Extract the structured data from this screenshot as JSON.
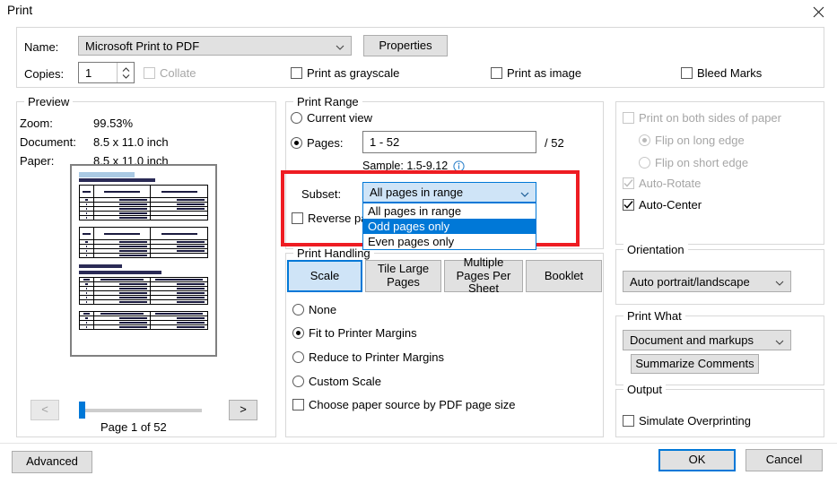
{
  "window": {
    "title": "Print",
    "close_icon": "close-icon"
  },
  "printer": {
    "name_label": "Name:",
    "name_value": "Microsoft Print to PDF",
    "properties_label": "Properties",
    "copies_label": "Copies:",
    "copies_value": "1",
    "collate_label": "Collate",
    "collate_checked": false,
    "collate_enabled": false,
    "print_as_grayscale_label": "Print as grayscale",
    "print_as_image_label": "Print as image",
    "bleed_marks_label": "Bleed Marks"
  },
  "preview": {
    "legend": "Preview",
    "zoom_label": "Zoom:",
    "zoom_value": "99.53%",
    "document_label": "Document:",
    "document_value": "8.5 x 11.0 inch",
    "paper_label": "Paper:",
    "paper_value": "8.5 x 11.0 inch",
    "prev_label": "<",
    "next_label": ">",
    "page_status": "Page 1 of 52"
  },
  "print_range": {
    "legend": "Print Range",
    "current_view_label": "Current view",
    "pages_label": "Pages:",
    "pages_value": "1 - 52",
    "total_pages": "/ 52",
    "sample_text": "Sample: 1.5-9.12",
    "info_icon": "info-icon",
    "subset_label": "Subset:",
    "subset_value": "All pages in range",
    "subset_options": [
      "All pages in range",
      "Odd pages only",
      "Even pages only"
    ],
    "subset_highlighted_index": 1,
    "reverse_pages_label": "Reverse pages"
  },
  "print_handling": {
    "legend": "Print Handling",
    "tabs": [
      {
        "label": "Scale",
        "active": true
      },
      {
        "label": "Tile Large Pages",
        "active": false
      },
      {
        "label": "Multiple Pages Per Sheet",
        "active": false
      },
      {
        "label": "Booklet",
        "active": false
      }
    ],
    "scale_options": [
      {
        "label": "None",
        "selected": false
      },
      {
        "label": "Fit to Printer Margins",
        "selected": true
      },
      {
        "label": "Reduce to Printer Margins",
        "selected": false
      },
      {
        "label": "Custom Scale",
        "selected": false
      }
    ],
    "paper_source_label": "Choose paper source by PDF page size",
    "paper_source_checked": false
  },
  "duplex": {
    "both_sides_label": "Print on both sides of paper",
    "both_sides_checked": false,
    "both_sides_enabled": false,
    "flip_long_label": "Flip on long edge",
    "flip_long_selected": true,
    "flip_short_label": "Flip on short edge",
    "flip_short_selected": false,
    "auto_rotate_label": "Auto-Rotate",
    "auto_rotate_checked": true,
    "auto_rotate_enabled": false,
    "auto_center_label": "Auto-Center",
    "auto_center_checked": true
  },
  "orientation": {
    "legend": "Orientation",
    "value": "Auto portrait/landscape"
  },
  "print_what": {
    "legend": "Print What",
    "value": "Document and markups",
    "summarize_label": "Summarize Comments"
  },
  "output": {
    "legend": "Output",
    "simulate_overprinting_label": "Simulate Overprinting",
    "simulate_overprinting_checked": false
  },
  "footer": {
    "advanced_label": "Advanced",
    "ok_label": "OK",
    "cancel_label": "Cancel"
  },
  "colors": {
    "accent": "#0078d7",
    "annotation": "#ee1c22",
    "combo_open": "#cfe4f7",
    "list_selected": "#0078d7"
  }
}
